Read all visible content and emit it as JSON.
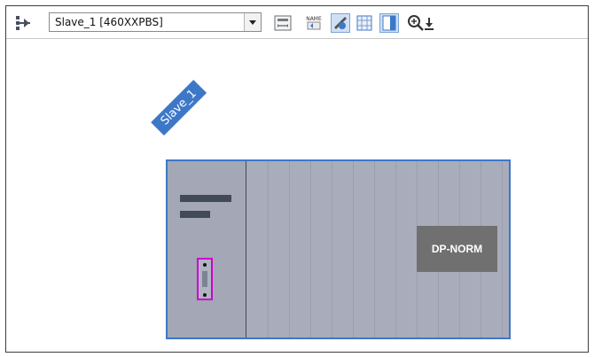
{
  "toolbar": {
    "device_selector": {
      "value": "Slave_1 [460XXPBS]"
    },
    "icons": [
      "network-view-icon",
      "dropdown-arrow-icon",
      "show-address-icon",
      "show-name-icon",
      "sketch-icon",
      "grid-icon",
      "table-icon",
      "zoom-in-icon",
      "download-icon"
    ]
  },
  "device": {
    "name_tag": "Slave_1",
    "module_label": "DP-NORM"
  },
  "colors": {
    "accent": "#3d78c8",
    "device_body": "#a8acbb",
    "module_box": "#707070",
    "port_highlight": "#d000d0"
  }
}
